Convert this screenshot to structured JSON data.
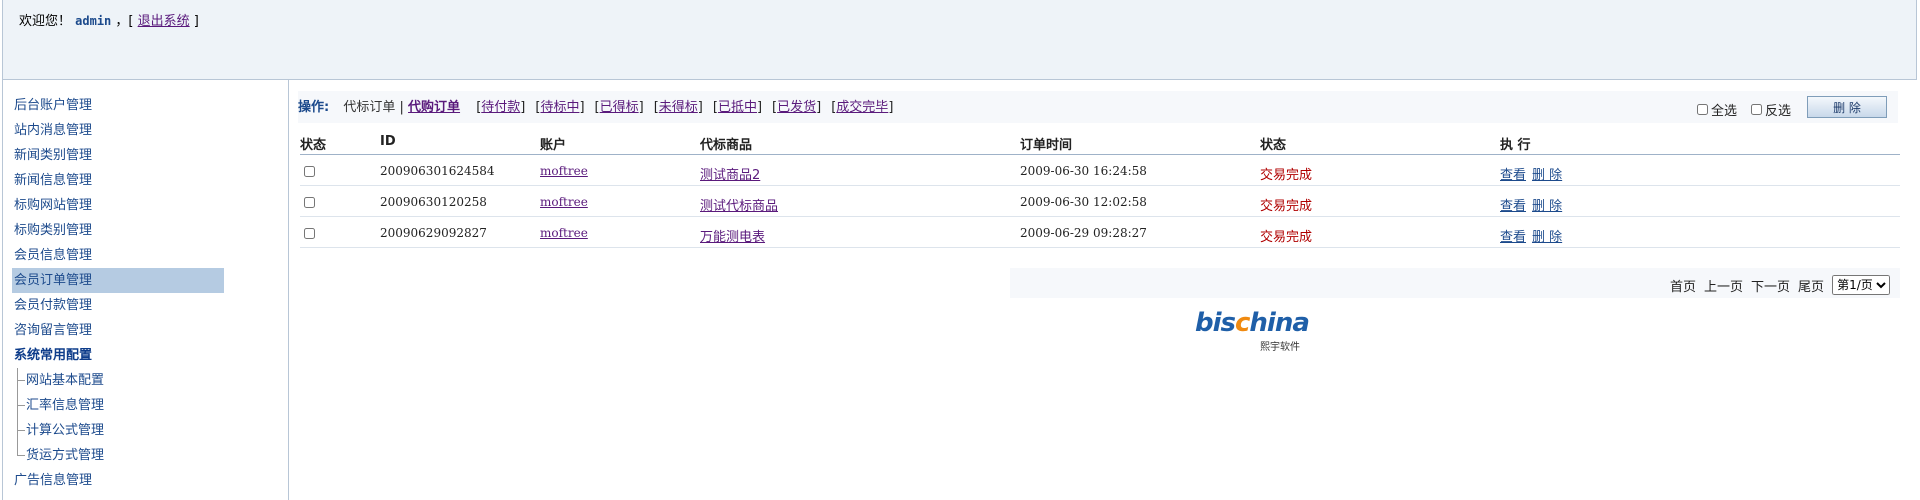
{
  "header": {
    "welcome": "欢迎您！",
    "username": "admin",
    "sep_open": "，[",
    "logout": "退出系统",
    "sep_close": "]"
  },
  "sidebar": {
    "items": [
      {
        "label": "后台账户管理",
        "type": "item"
      },
      {
        "label": "站内消息管理",
        "type": "item"
      },
      {
        "label": "新闻类别管理",
        "type": "item"
      },
      {
        "label": "新闻信息管理",
        "type": "item"
      },
      {
        "label": "标购网站管理",
        "type": "item"
      },
      {
        "label": "标购类别管理",
        "type": "item"
      },
      {
        "label": "会员信息管理",
        "type": "item"
      },
      {
        "label": "会员订单管理",
        "type": "item",
        "active": true
      },
      {
        "label": "会员付款管理",
        "type": "item"
      },
      {
        "label": "咨询留言管理",
        "type": "item"
      },
      {
        "label": "系统常用配置",
        "type": "group"
      },
      {
        "label": "网站基本配置",
        "type": "sub"
      },
      {
        "label": "汇率信息管理",
        "type": "sub"
      },
      {
        "label": "计算公式管理",
        "type": "sub"
      },
      {
        "label": "货运方式管理",
        "type": "sub"
      },
      {
        "label": "广告信息管理",
        "type": "item"
      }
    ]
  },
  "ops": {
    "label": "操作:",
    "tab_a": "代标订单",
    "divider": "|",
    "tab_b": "代购订单",
    "filters": [
      "待付款",
      "待标中",
      "已得标",
      "未得标",
      "已抵中",
      "已发货",
      "成交完毕"
    ]
  },
  "controls": {
    "select_all": "全选",
    "invert": "反选",
    "delete": "删 除"
  },
  "table": {
    "headers": [
      "状态",
      "ID",
      "账户",
      "代标商品",
      "订单时间",
      "状态",
      "执  行"
    ],
    "rows": [
      {
        "id": "200906301624584",
        "account": "moftree",
        "product": "测试商品2",
        "time": "2009-06-30 16:24:58",
        "status": "交易完成",
        "view": "查看",
        "del": "删 除"
      },
      {
        "id": "20090630120258",
        "account": "moftree",
        "product": "测试代标商品",
        "time": "2009-06-30 12:02:58",
        "status": "交易完成",
        "view": "查看",
        "del": "删 除"
      },
      {
        "id": "20090629092827",
        "account": "moftree",
        "product": "万能测电表",
        "time": "2009-06-29 09:28:27",
        "status": "交易完成",
        "view": "查看",
        "del": "删 除"
      }
    ]
  },
  "pager": {
    "first": "首页",
    "prev": "上一页",
    "next": "下一页",
    "last": "尾页",
    "selected": "第1/页"
  },
  "watermark": {
    "logo_blue": "bis",
    "logo_orange": "c",
    "logo_rest": "hina",
    "sub": "熙宇软件"
  }
}
